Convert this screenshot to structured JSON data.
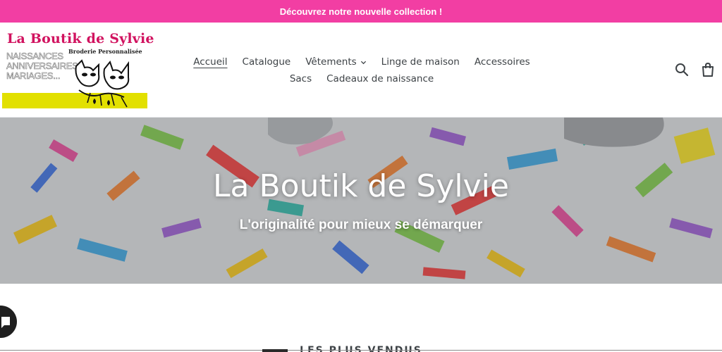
{
  "colors": {
    "announcement_bg": "#f23ea3",
    "logo_title": "#d1125f",
    "logo_band": "#e2e000",
    "nav_text": "#3d4246",
    "hero_title": "#ffffff"
  },
  "announcement": {
    "text": "Découvrez notre nouvelle collection !"
  },
  "logo": {
    "title": "La Boutik de Sylvie",
    "subtitle": "Broderie Personnalisée",
    "lines": [
      "NAISSANCES",
      "ANNIVERSAIRES",
      "MARIAGES..."
    ]
  },
  "nav": {
    "row1": [
      {
        "label": "Accueil",
        "active": true
      },
      {
        "label": "Catalogue"
      },
      {
        "label": "Vêtements",
        "dropdown": true
      },
      {
        "label": "Linge de maison"
      },
      {
        "label": "Accessoires"
      }
    ],
    "row2": [
      {
        "label": "Sacs"
      },
      {
        "label": "Cadeaux de naissance"
      }
    ]
  },
  "header_icons": [
    "search-icon",
    "cart-icon"
  ],
  "hero": {
    "title": "La Boutik de Sylvie",
    "subtitle": "L'originalité pour mieux se démarquer"
  },
  "section": {
    "title": "LES PLUS VENDUS"
  }
}
